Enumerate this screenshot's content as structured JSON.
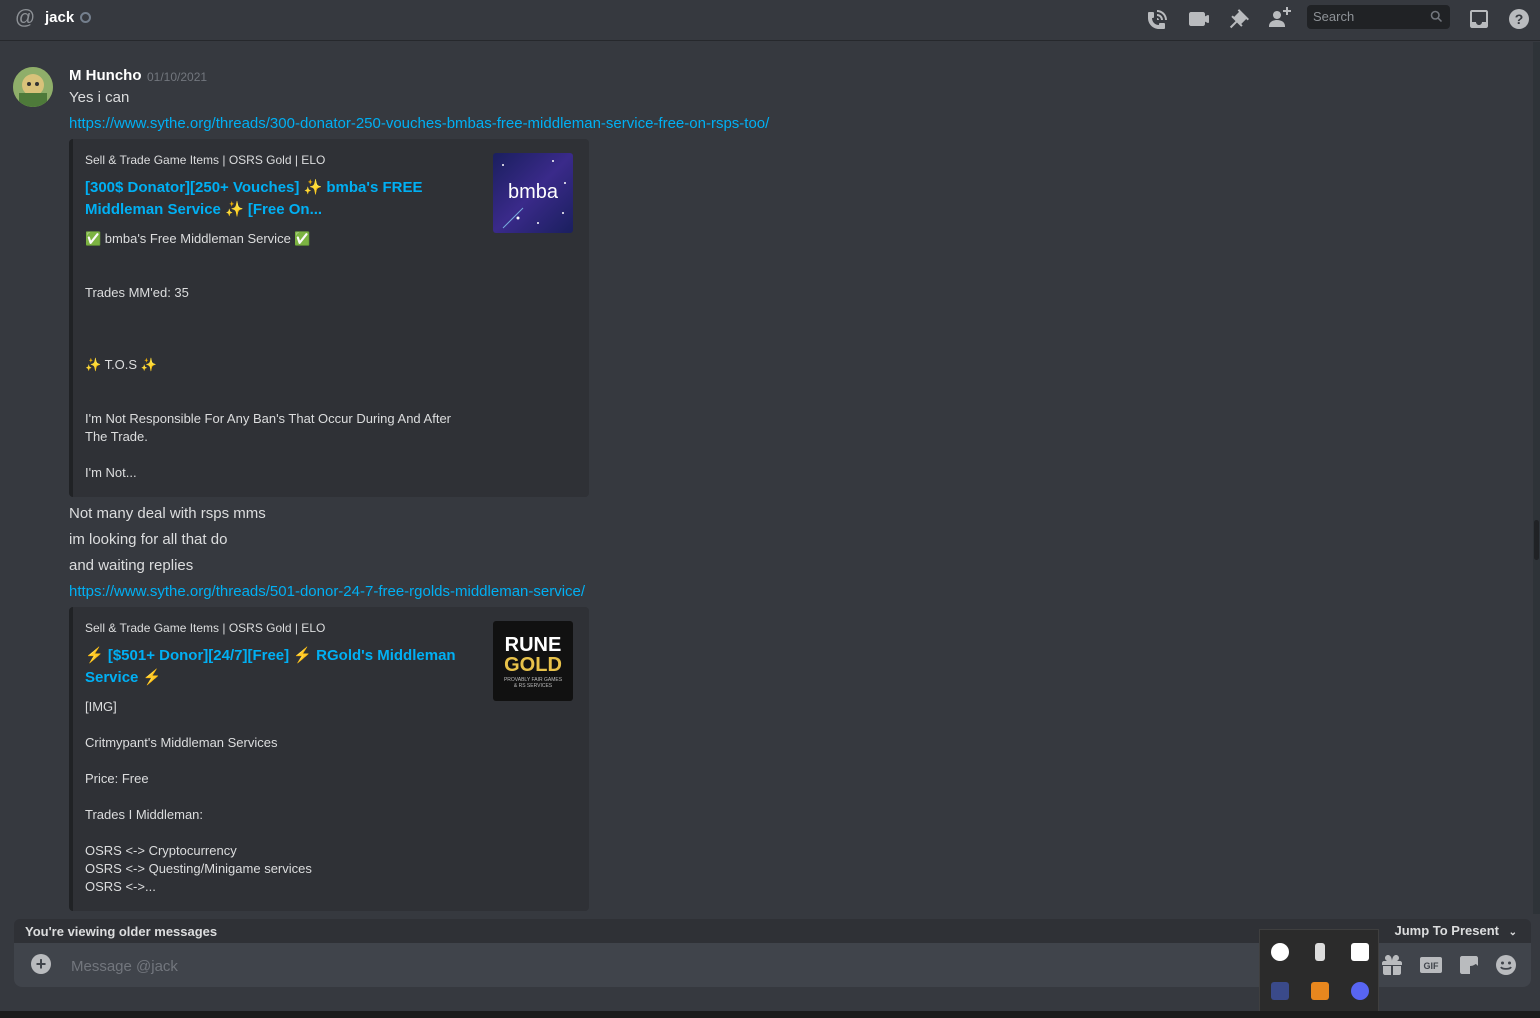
{
  "header": {
    "recipient": "jack",
    "search_placeholder": "Search",
    "icons": [
      "at-icon",
      "call-icon",
      "video-icon",
      "pin-icon",
      "add-friend-icon",
      "search-icon",
      "inbox-icon",
      "help-icon"
    ]
  },
  "message": {
    "author": "M Huncho",
    "timestamp": "01/10/2021",
    "lines": {
      "l1": "Yes i can",
      "link1": "https://www.sythe.org/threads/300-donator-250-vouches-bmbas-free-middleman-service-free-on-rsps-too/",
      "l2": "Not many deal with rsps mms",
      "l3": "im looking for all that do",
      "l4": "and waiting replies",
      "link2": "https://www.sythe.org/threads/501-donor-24-7-free-rgolds-middleman-service/"
    }
  },
  "embed1": {
    "provider": "Sell & Trade Game Items | OSRS Gold | ELO",
    "title_line1": "[300$ Donator][250+ Vouches] ✨ bmba's FREE",
    "title_line2": "Middleman Service ✨ [Free On...",
    "desc1": "✅ bmba's Free Middleman Service ✅",
    "desc2": "Trades MM'ed: 35",
    "desc3": "✨ T.O.S ✨",
    "desc4": "I'm Not Responsible For Any Ban's That Occur During And After\nThe Trade.",
    "desc5": "I'm Not...",
    "thumb_text": "bmba"
  },
  "embed2": {
    "provider": "Sell & Trade Game Items | OSRS Gold | ELO",
    "title_line1": "⚡ [$501+ Donor][24/7][Free] ⚡ RGold's Middleman",
    "title_line2": "Service ⚡",
    "desc1": "[IMG]",
    "desc2": "Critmypant's Middleman Services",
    "desc3": "Price: Free",
    "desc4": "Trades I Middleman:",
    "desc5": "OSRS <-> Cryptocurrency\nOSRS <-> Questing/Minigame services\nOSRS <->...",
    "thumb_line1": "RUNE",
    "thumb_line2": "GOLD",
    "thumb_line3": "PROVABLY FAIR GAMES\n& RS SERVICES"
  },
  "footer": {
    "older_text": "You're viewing older messages",
    "jump_label": "Jump To Present",
    "composer_placeholder": "Message @jack"
  },
  "colors": {
    "background": "#36393f",
    "link": "#00b0f4",
    "embed_bg": "#2f3136",
    "composer_bg": "#40444b"
  }
}
